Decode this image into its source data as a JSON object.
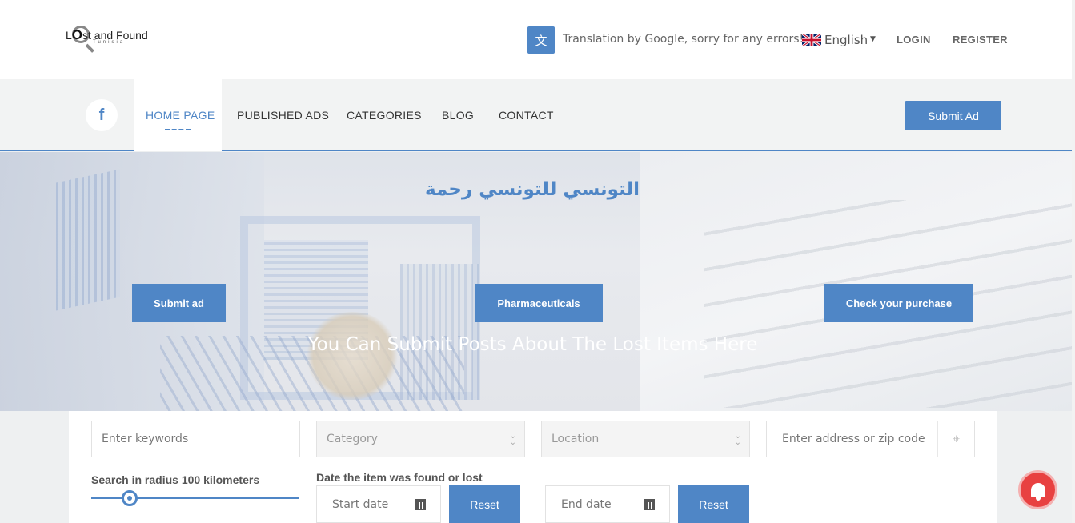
{
  "header": {
    "logo": {
      "text_pre": "L",
      "text_o": "O",
      "text_post": "st and Found",
      "sub": "Tunisia"
    },
    "translate_note": "Translation by Google, sorry for any errors!",
    "language": "English",
    "login_label": "LOGIN",
    "register_label": "REGISTER"
  },
  "nav": {
    "items": [
      {
        "label": "HOME PAGE",
        "active": true
      },
      {
        "label": "PUBLISHED ADS"
      },
      {
        "label": "CATEGORIES"
      },
      {
        "label": "BLOG"
      },
      {
        "label": "CONTACT"
      }
    ],
    "submit_label": "Submit Ad",
    "facebook_glyph": "f"
  },
  "hero": {
    "arabic_title": "التونسي للتونسي رحمة",
    "buttons": [
      "Submit ad",
      "Pharmaceuticals",
      "Check your purchase"
    ],
    "tagline": "You Can Submit Posts About The Lost Items Here"
  },
  "search": {
    "keywords_placeholder": "Enter keywords",
    "category_placeholder": "Category",
    "location_placeholder": "Location",
    "address_placeholder": "Enter address or zip code",
    "radius_label": "Search in radius 100 kilometers",
    "radius_km": 100,
    "date_label": "Date the item was found or lost",
    "start_date_placeholder": "Start date",
    "end_date_placeholder": "End date",
    "reset_label": "Reset"
  },
  "colors": {
    "accent": "#4f86c6",
    "notification": "#e84141"
  }
}
